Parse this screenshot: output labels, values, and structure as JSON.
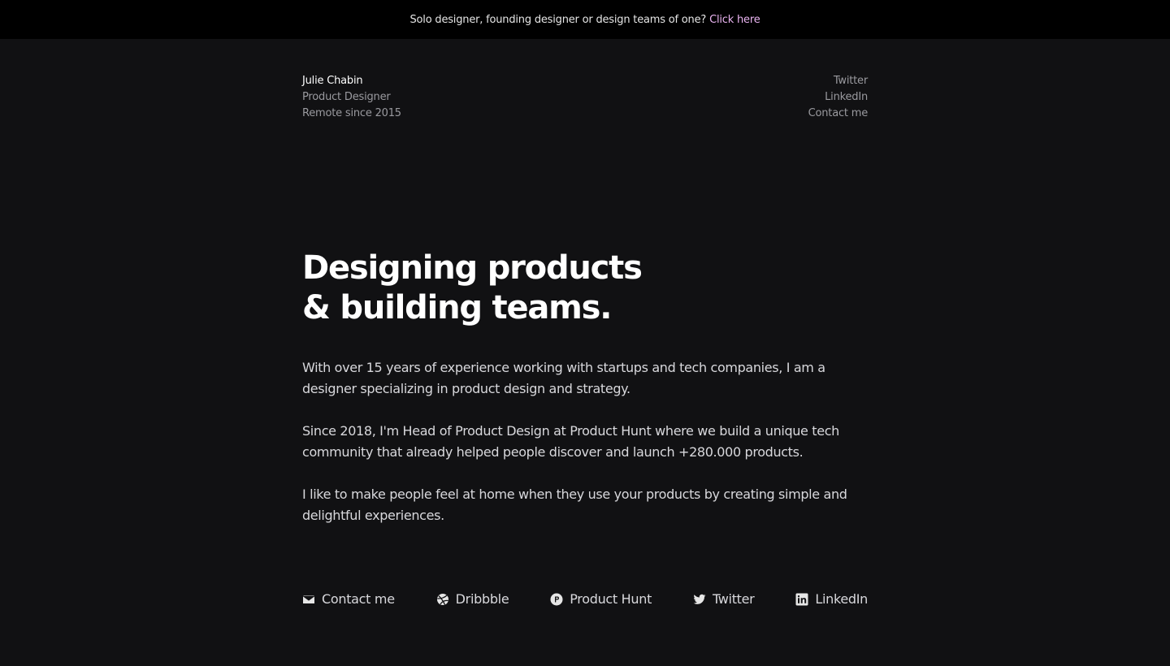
{
  "banner": {
    "text": "Solo designer, founding designer or design teams of one?",
    "link": "Click here"
  },
  "profile": {
    "name": "Julie Chabin",
    "role": "Product Designer",
    "location": "Remote since 2015"
  },
  "header_links": [
    "Twitter",
    "LinkedIn",
    "Contact me"
  ],
  "hero": {
    "line1": "Designing products",
    "line2": "& building teams."
  },
  "bio": [
    "With over 15 years of experience working with startups and tech companies, I am a designer specializing in product design and strategy.",
    "Since 2018, I'm Head of Product Design at Product Hunt where we build a unique tech community that already helped people discover and launch +280.000 products.",
    "I like to make people feel at home when they use your products by creating simple and delightful experiences."
  ],
  "footer_links": [
    {
      "label": "Contact me",
      "icon": "mail-icon"
    },
    {
      "label": "Dribbble",
      "icon": "dribbble-icon"
    },
    {
      "label": "Product Hunt",
      "icon": "product-hunt-icon"
    },
    {
      "label": "Twitter",
      "icon": "twitter-icon"
    },
    {
      "label": "LinkedIn",
      "icon": "linkedin-icon"
    }
  ],
  "colors": {
    "background": "#111113",
    "banner_bg": "#000000",
    "accent_link": "#e9b3f0"
  }
}
